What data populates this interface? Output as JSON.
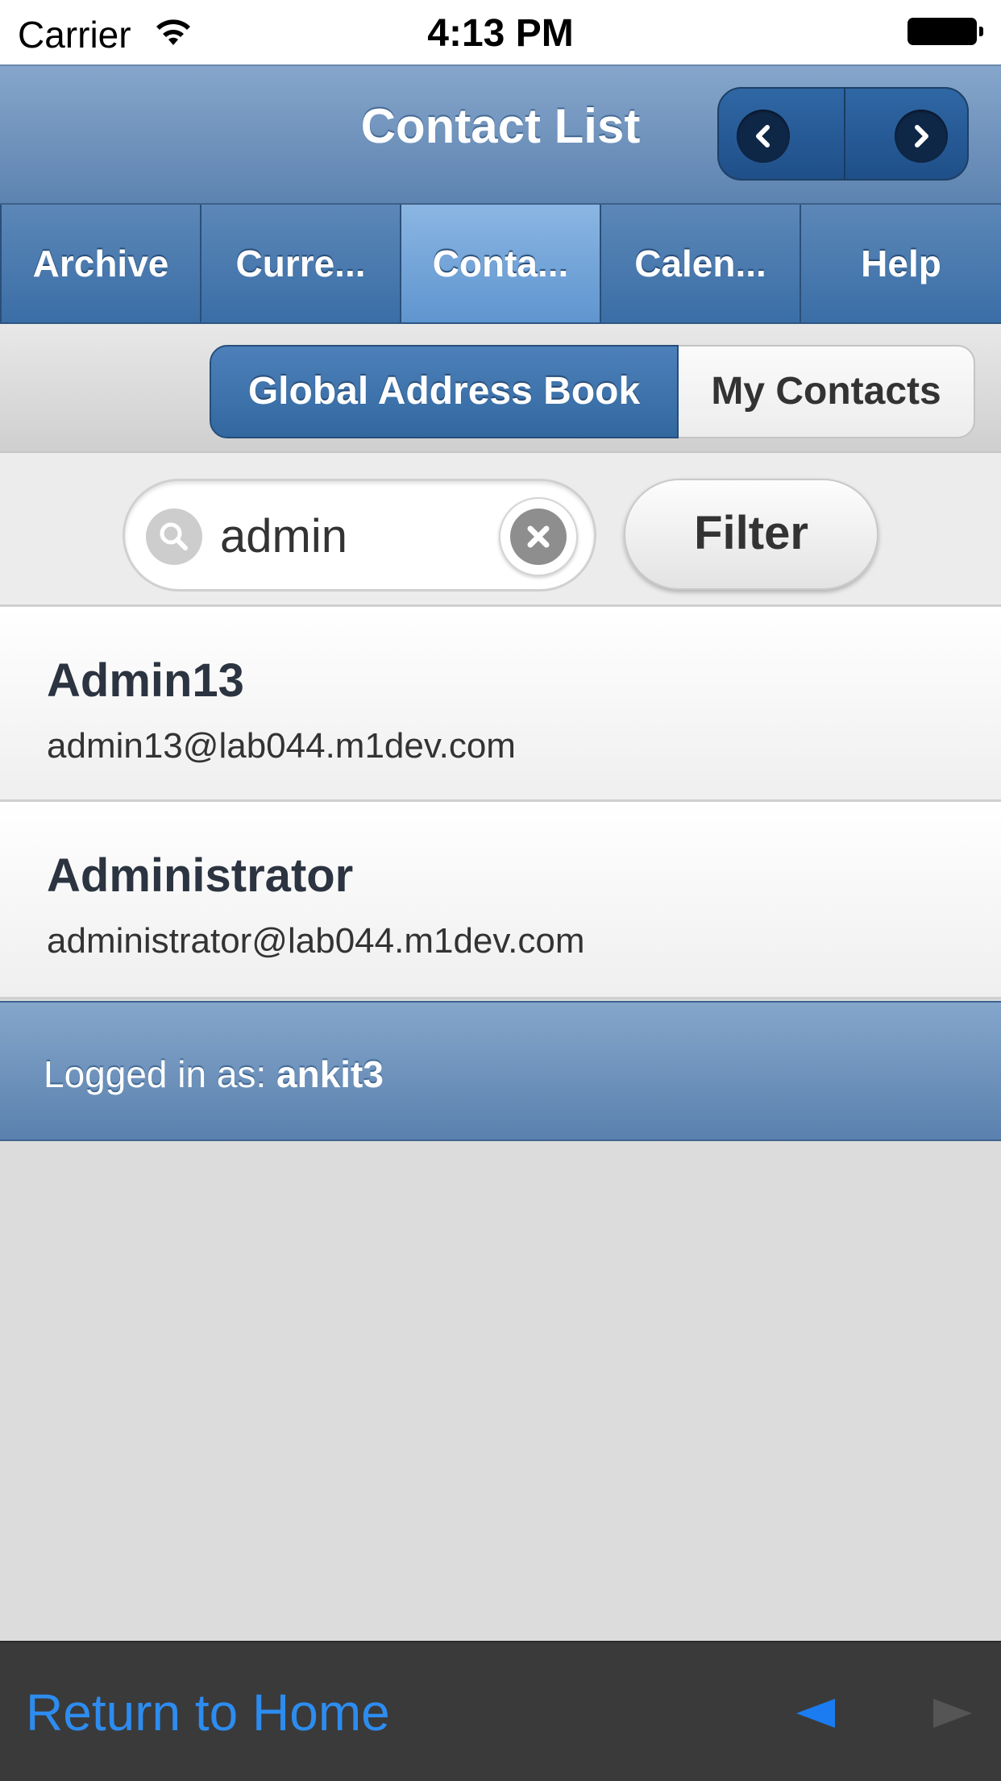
{
  "status_bar": {
    "carrier": "Carrier",
    "time": "4:13 PM"
  },
  "header": {
    "title": "Contact List"
  },
  "tabs": [
    {
      "label": "Archive"
    },
    {
      "label": "Curre..."
    },
    {
      "label": "Conta...",
      "active": true
    },
    {
      "label": "Calen..."
    },
    {
      "label": "Help"
    }
  ],
  "segmented": {
    "global_label": "Global Address Book",
    "mine_label": "My Contacts",
    "selected": "Global Address Book"
  },
  "search": {
    "value": "admin",
    "filter_label": "Filter"
  },
  "contacts": [
    {
      "name": "Admin13",
      "email": "admin13@lab044.m1dev.com"
    },
    {
      "name": "Administrator",
      "email": "administrator@lab044.m1dev.com"
    }
  ],
  "footer": {
    "logged_in_prefix": "Logged in as: ",
    "username": "ankit3"
  },
  "toolbar": {
    "home_label": "Return to Home"
  },
  "colors": {
    "header_blue": "#5d83b0",
    "tab_active": "#6f9fd6",
    "link_blue": "#2d8cf0",
    "toolbar_bg": "#3a3a3a"
  }
}
